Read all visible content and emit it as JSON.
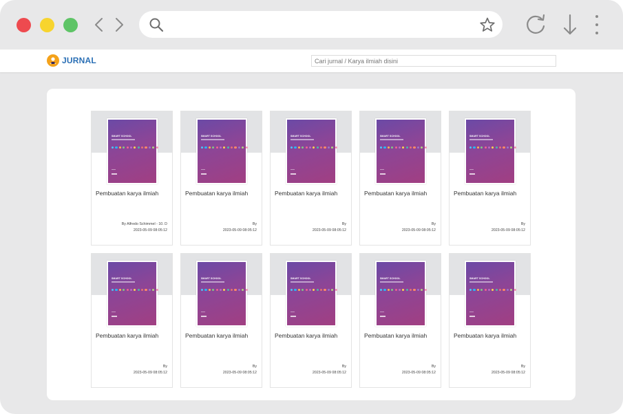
{
  "browser": {
    "url": "",
    "icons": {
      "back": "chevron-left-icon",
      "forward": "chevron-right-icon",
      "search": "search-icon",
      "bookmark": "star-icon",
      "reload": "reload-icon",
      "download": "download-icon",
      "menu": "kebab-menu-icon"
    }
  },
  "header": {
    "brand": "JURNAL",
    "search_placeholder": "Cari jurnal / Karya ilmiah disini"
  },
  "cover": {
    "title": "SMART SCHOOL"
  },
  "colors": {
    "brand": "#2a6fb5",
    "logo": "#f4a21b",
    "cover_top": "#6b4aa6",
    "cover_bottom": "#a13f82"
  },
  "cards": [
    {
      "title": "Pembuatan karya ilmiah",
      "author": "By Alfredo Schimmel - 10. D",
      "date": "2023-05-09 08:05:12"
    },
    {
      "title": "Pembuatan karya ilmiah",
      "author": "By",
      "date": "2023-05-09 08:05:12"
    },
    {
      "title": "Pembuatan karya ilmiah",
      "author": "By",
      "date": "2023-05-09 08:05:12"
    },
    {
      "title": "Pembuatan karya ilmiah",
      "author": "By",
      "date": "2023-05-09 08:05:12"
    },
    {
      "title": "Pembuatan karya ilmiah",
      "author": "By",
      "date": "2023-05-09 08:05:12"
    },
    {
      "title": "Pembuatan karya ilmiah",
      "author": "By",
      "date": "2023-05-09 08:05:12"
    },
    {
      "title": "Pembuatan karya ilmiah",
      "author": "By",
      "date": "2023-05-09 08:05:12"
    },
    {
      "title": "Pembuatan karya ilmiah",
      "author": "By",
      "date": "2023-05-09 08:05:12"
    },
    {
      "title": "Pembuatan karya ilmiah",
      "author": "By",
      "date": "2023-05-09 08:05:12"
    },
    {
      "title": "Pembuatan karya ilmiah",
      "author": "By",
      "date": "2023-05-09 08:05:12"
    }
  ]
}
